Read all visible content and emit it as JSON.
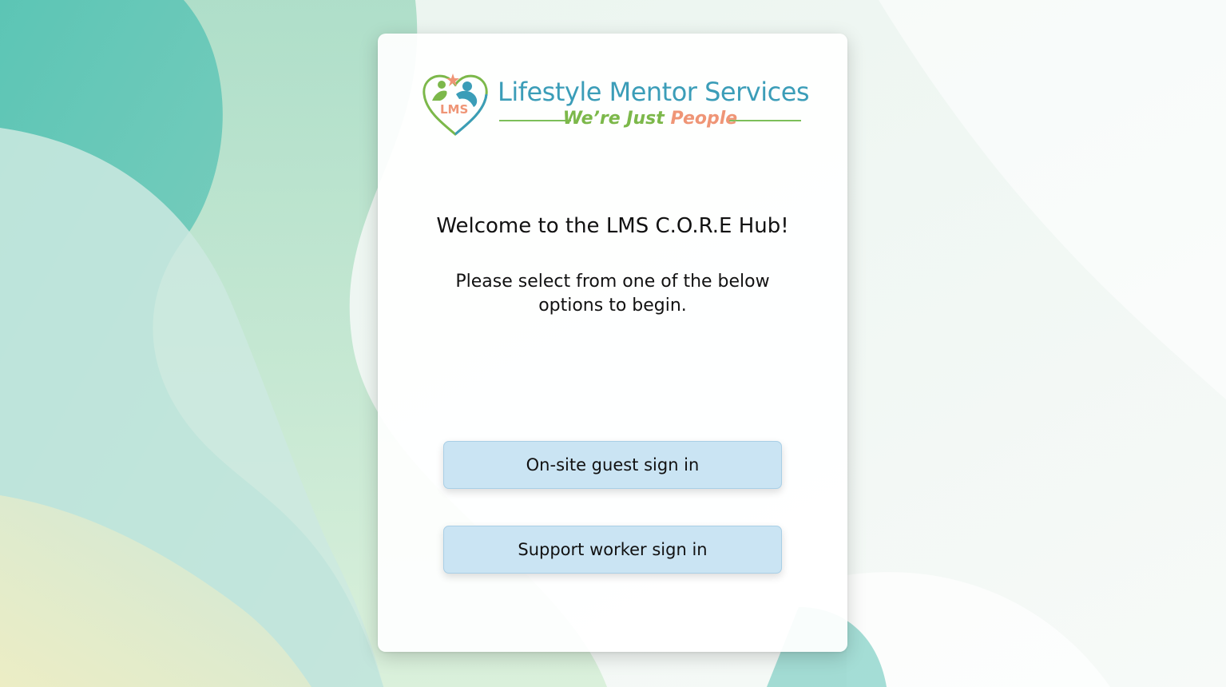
{
  "brand": {
    "name": "Lifestyle Mentor Services",
    "tagline_part1": "We’re Just",
    "tagline_part2": "People",
    "mark_text": "LMS",
    "colors": {
      "primary_blue": "#3b9db8",
      "green": "#7cb84a",
      "coral": "#ef9576"
    }
  },
  "main": {
    "welcome": "Welcome to the LMS C.O.R.E Hub!",
    "instructions": "Please select from one of the below options to begin."
  },
  "actions": {
    "guest_sign_in": "On-site guest sign in",
    "worker_sign_in": "Support worker sign in"
  },
  "theme": {
    "button_bg": "#cae4f3",
    "background_accent": "#54c0b3"
  }
}
